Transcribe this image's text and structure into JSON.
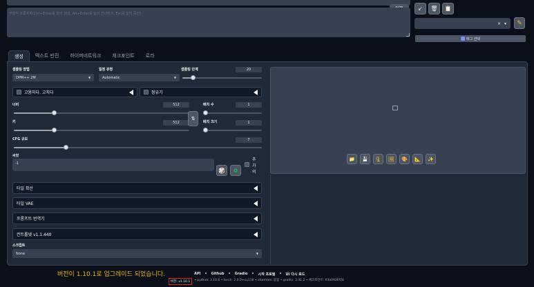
{
  "prompt": {
    "counter": "0/75",
    "negative_placeholder": "부정적 프롬프트(Ctrl+Enter를 눌러 생성, Alt+Enter를 눌러 건너뛰기, Esc를 눌러 중단)"
  },
  "toolbar": {
    "style_clear": "×",
    "style_dropdown": "▾",
    "tag_select": "태그 선택"
  },
  "tabs": [
    {
      "label": "생성"
    },
    {
      "label": "텍스트 반전"
    },
    {
      "label": "하이퍼네트워크"
    },
    {
      "label": "체크포인트"
    },
    {
      "label": "로라"
    }
  ],
  "sampling": {
    "method_label": "샘플링 방법",
    "method_value": "DPM++ 2M",
    "schedule_label": "일정 유형",
    "schedule_value": "Automatic",
    "steps_label": "샘플링 단계",
    "steps_value": "20",
    "steps_fraction": 0.13
  },
  "options": {
    "hires_label": "고용하다. 고치다",
    "refiner_label": "정유기"
  },
  "size": {
    "width_label": "너비",
    "width_value": "512",
    "width_fraction": 0.23,
    "height_label": "키",
    "height_value": "512",
    "height_fraction": 0.23,
    "swap_icon": "⇅",
    "batch_count_label": "배치 수",
    "batch_count_value": "1",
    "batch_size_label": "배치 크기",
    "batch_size_value": "1"
  },
  "cfg": {
    "label": "CFG 규모",
    "value": "7",
    "fraction": 0.21
  },
  "seed": {
    "label": "씨앗",
    "value": "-1",
    "extra_label_1": "추",
    "extra_label_2": "가",
    "extra_label_3": "의"
  },
  "accordions": [
    {
      "label": "타일 확산"
    },
    {
      "label": "타일 VAE"
    },
    {
      "label": "프롬프트 번역기"
    },
    {
      "label": "컨트롤넷 v1.1.440"
    }
  ],
  "script": {
    "label": "스크립트",
    "value": "None"
  },
  "footer": {
    "message": "버전이 1.10.1로 업그레이드 되었습니다.",
    "links": [
      "API",
      "•",
      "Github",
      "•",
      "Gradio",
      "•",
      "시작 프로필",
      "•",
      "UI 다시 로드"
    ],
    "version": "버전: v1.10.1",
    "info": "• python: 3.10.6  •  torch: 2.0.0+cu118  •  xformers: 없음  •  gradio: 3.41.2  •  체크포인트: 63a0936f78"
  },
  "colors": {
    "background": "#0b0f19",
    "panel": "#1f2937",
    "field": "#374151",
    "accent_yellow": "#eab308",
    "version_border": "#dc2626"
  }
}
